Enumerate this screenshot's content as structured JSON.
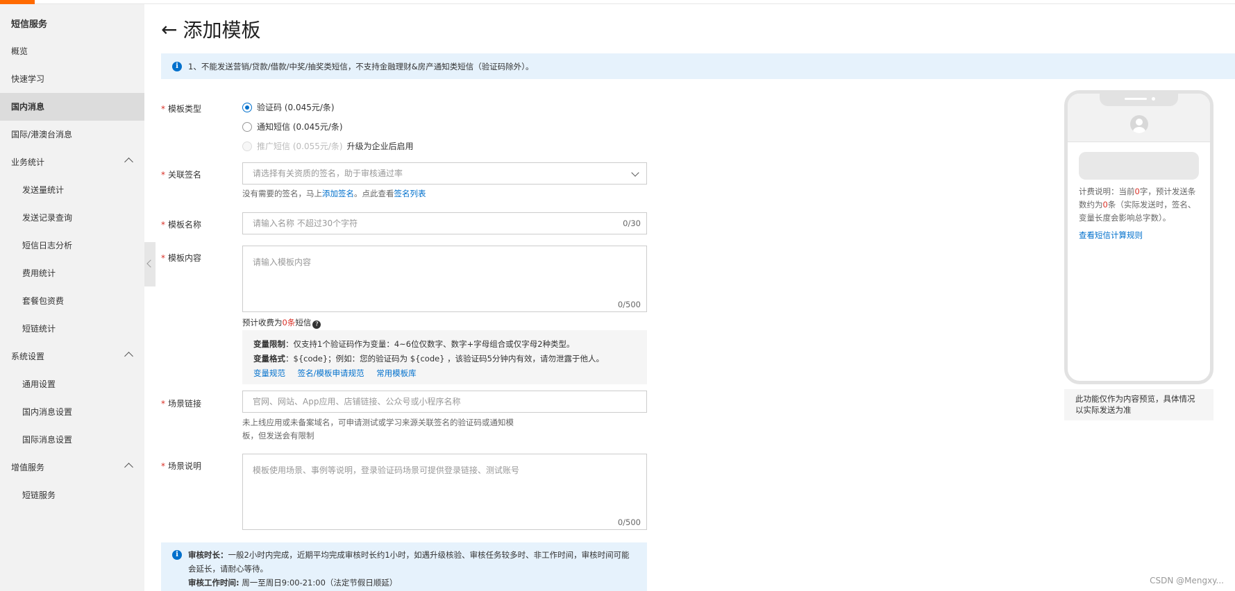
{
  "sidebar": {
    "title": "短信服务",
    "items": [
      {
        "label": "概览",
        "sub": false
      },
      {
        "label": "快速学习",
        "sub": false
      },
      {
        "label": "国内消息",
        "sub": false,
        "active": true
      },
      {
        "label": "国际/港澳台消息",
        "sub": false
      },
      {
        "label": "业务统计",
        "sub": false,
        "group": true
      },
      {
        "label": "发送量统计",
        "sub": true
      },
      {
        "label": "发送记录查询",
        "sub": true
      },
      {
        "label": "短信日志分析",
        "sub": true
      },
      {
        "label": "费用统计",
        "sub": true
      },
      {
        "label": "套餐包资费",
        "sub": true
      },
      {
        "label": "短链统计",
        "sub": true
      },
      {
        "label": "系统设置",
        "sub": false,
        "group": true
      },
      {
        "label": "通用设置",
        "sub": true
      },
      {
        "label": "国内消息设置",
        "sub": true
      },
      {
        "label": "国际消息设置",
        "sub": true
      },
      {
        "label": "增值服务",
        "sub": false,
        "group": true
      },
      {
        "label": "短链服务",
        "sub": true
      }
    ]
  },
  "page": {
    "back_icon": "←",
    "title": "添加模板",
    "notice": "1、不能发送营销/贷款/借款/中奖/抽奖类短信，不支持金融理财&房产通知类短信（验证码除外）。"
  },
  "form": {
    "template_type": {
      "label": "模板类型",
      "options": [
        {
          "label": "验证码 (0.045元/条)",
          "checked": true
        },
        {
          "label": "通知短信 (0.045元/条)",
          "checked": false
        },
        {
          "label": "推广短信 (0.055元/条)",
          "disabled": true
        }
      ],
      "upgrade_text": "升级为企业后启用"
    },
    "signature": {
      "label": "关联签名",
      "placeholder": "请选择有关资质的签名，助于审核通过率",
      "hint_prefix": "没有需要的签名，马上",
      "hint_link1": "添加签名",
      "hint_middle": "。点此查看",
      "hint_link2": "签名列表"
    },
    "name": {
      "label": "模板名称",
      "placeholder": "请输入名称 不超过30个字符",
      "counter": "0/30"
    },
    "content": {
      "label": "模板内容",
      "placeholder": "请输入模板内容",
      "counter": "0/500",
      "fee_prefix": "预计收费为",
      "fee_count": "0条",
      "fee_suffix": "短信",
      "help_icon": "?"
    },
    "variables": {
      "limit_label": "变量限制",
      "limit_text": "：仅支持1个验证码作为变量：4~6位仅数字、数字+字母组合或仅字母2种类型。",
      "format_label": "变量格式",
      "format_text": "：${code}；例如：您的验证码为 ${code} ，该验证码5分钟内有效，请勿泄露于他人。",
      "links": [
        "变量规范",
        "签名/模板申请规范",
        "常用模板库"
      ]
    },
    "scene_link": {
      "label": "场景链接",
      "placeholder": "官网、网站、App应用、店铺链接、公众号或小程序名称",
      "hint_line1": "未上线应用或未备案域名，可申请测试或学习来源关联签名的验证码或通知模",
      "hint_line2": "板，但发送会有限制"
    },
    "scene_desc": {
      "label": "场景说明",
      "placeholder": "模板使用场景、事例等说明，登录验证码场景可提供登录链接、测试账号",
      "counter": "0/500"
    }
  },
  "audit": {
    "duration_label": "审核时长：",
    "duration_text": "一般2小时内完成，近期平均完成审核时长约1小时，如遇升级核验、审核任务较多时、非工作时间，审核时间可能会延长，请耐心等待。",
    "hours_label": "审核工作时间:",
    "hours_text": " 周一至周日9:00-21:00（法定节假日顺延）"
  },
  "preview": {
    "fee_text_1": "计费说明：当前",
    "fee_chars": "0",
    "fee_text_2": "字，预计发送条数约为",
    "fee_count": "0",
    "fee_text_3": "条（实际发送时，签名、变量长度会影响总字数）。",
    "rule_link": "查看短信计算规则",
    "note": "此功能仅作为内容预览，具体情况以实际发送为准"
  },
  "watermark": "CSDN @Mengxy...",
  "colors": {
    "accent": "#ff6a00",
    "link": "#0070cc",
    "required": "#d93026",
    "notice_bg": "#e6f2fc"
  }
}
